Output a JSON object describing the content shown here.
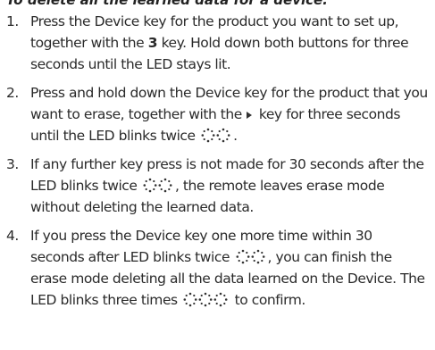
{
  "heading": "To delete all the learned data for a device:",
  "steps": [
    {
      "number": "1.",
      "a": "Press the Device key for the product you want to set up, together with the ",
      "key": "3",
      "b": " key. Hold down both buttons for three seconds until the LED stays lit."
    },
    {
      "number": "2.",
      "a": "Press and hold down the Device key for the product that you want to erase, together with the ",
      "key_icon": "play-triangle-icon",
      "b": " key for three seconds until the LED blinks twice ",
      "blink_icon": "led-blink-twice-icon",
      "c": "."
    },
    {
      "number": "3.",
      "a": "If any further key press is not made for 30 seconds after the LED blinks twice ",
      "blink_icon": "led-blink-twice-icon",
      "b": ", the remote leaves erase mode without deleting the learned data."
    },
    {
      "number": "4.",
      "a": "If you press the Device key one more time within 30 seconds after LED blinks twice ",
      "blink_icon": "led-blink-twice-icon",
      "b": ", you can finish the erase mode deleting all the data learned on the Device. The LED blinks three times ",
      "blink3_icon": "led-blink-three-times-icon",
      "c": " to confirm."
    }
  ]
}
